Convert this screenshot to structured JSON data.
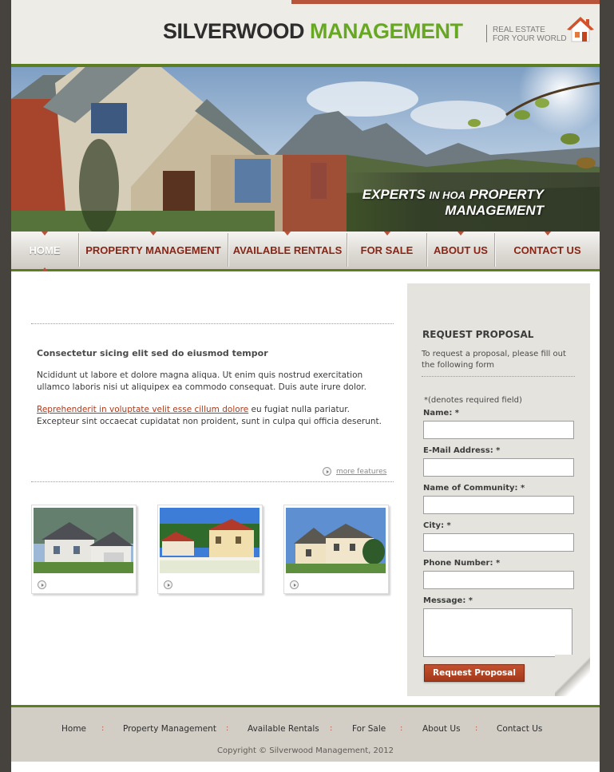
{
  "header": {
    "logo_part1": "SILVERWOOD",
    "logo_part2": "MANAGEMENT",
    "tagline_line1": "REAL ESTATE",
    "tagline_line2": "FOR YOUR WORLD"
  },
  "hero": {
    "tagline_experts": "EXPERTS",
    "tagline_in_hoa": "IN HOA",
    "tagline_property": "PROPERTY",
    "tagline_management": "MANAGEMENT"
  },
  "nav": {
    "items": [
      {
        "label": "HOME"
      },
      {
        "label": "PROPERTY MANAGEMENT"
      },
      {
        "label": "AVAILABLE RENTALS"
      },
      {
        "label": "FOR SALE"
      },
      {
        "label": "ABOUT US"
      },
      {
        "label": "CONTACT US"
      }
    ]
  },
  "main": {
    "article_title": "Consectetur sicing elit sed do eiusmod tempor",
    "paragraph1": "Ncididunt ut labore et dolore magna aliqua. Ut enim quis nostrud exercitation ullamco laboris nisi ut aliquipex ea commodo consequat. Duis aute irure dolor.",
    "paragraph2_link": "Reprehenderit in voluptate velit esse cillum dolore",
    "paragraph2_rest": " eu fugiat nulla pariatur. Excepteur sint occaecat cupidatat non proident, sunt in culpa qui officia deserunt.",
    "more_features": "more features"
  },
  "sidebar": {
    "title": "REQUEST PROPOSAL",
    "intro": "To request a proposal, please fill out the following form",
    "required_note": "*(denotes required field)",
    "fields": [
      {
        "label": "Name: *",
        "value": ""
      },
      {
        "label": "E-Mail Address: *",
        "value": ""
      },
      {
        "label": "Name of Community: *",
        "value": ""
      },
      {
        "label": "City: *",
        "value": ""
      },
      {
        "label": "Phone Number: *",
        "value": ""
      }
    ],
    "message_label": "Message: *",
    "submit_label": "Request Proposal"
  },
  "footer": {
    "links": [
      "Home",
      "Property Management",
      "Available Rentals",
      "For Sale",
      "About Us",
      "Contact Us"
    ],
    "separator": ":",
    "copyright": "Copyright © Silverwood Management, 2012"
  },
  "colors": {
    "brand_green": "#67a823",
    "accent_red": "#b6543c",
    "nav_text": "#8a2414"
  }
}
